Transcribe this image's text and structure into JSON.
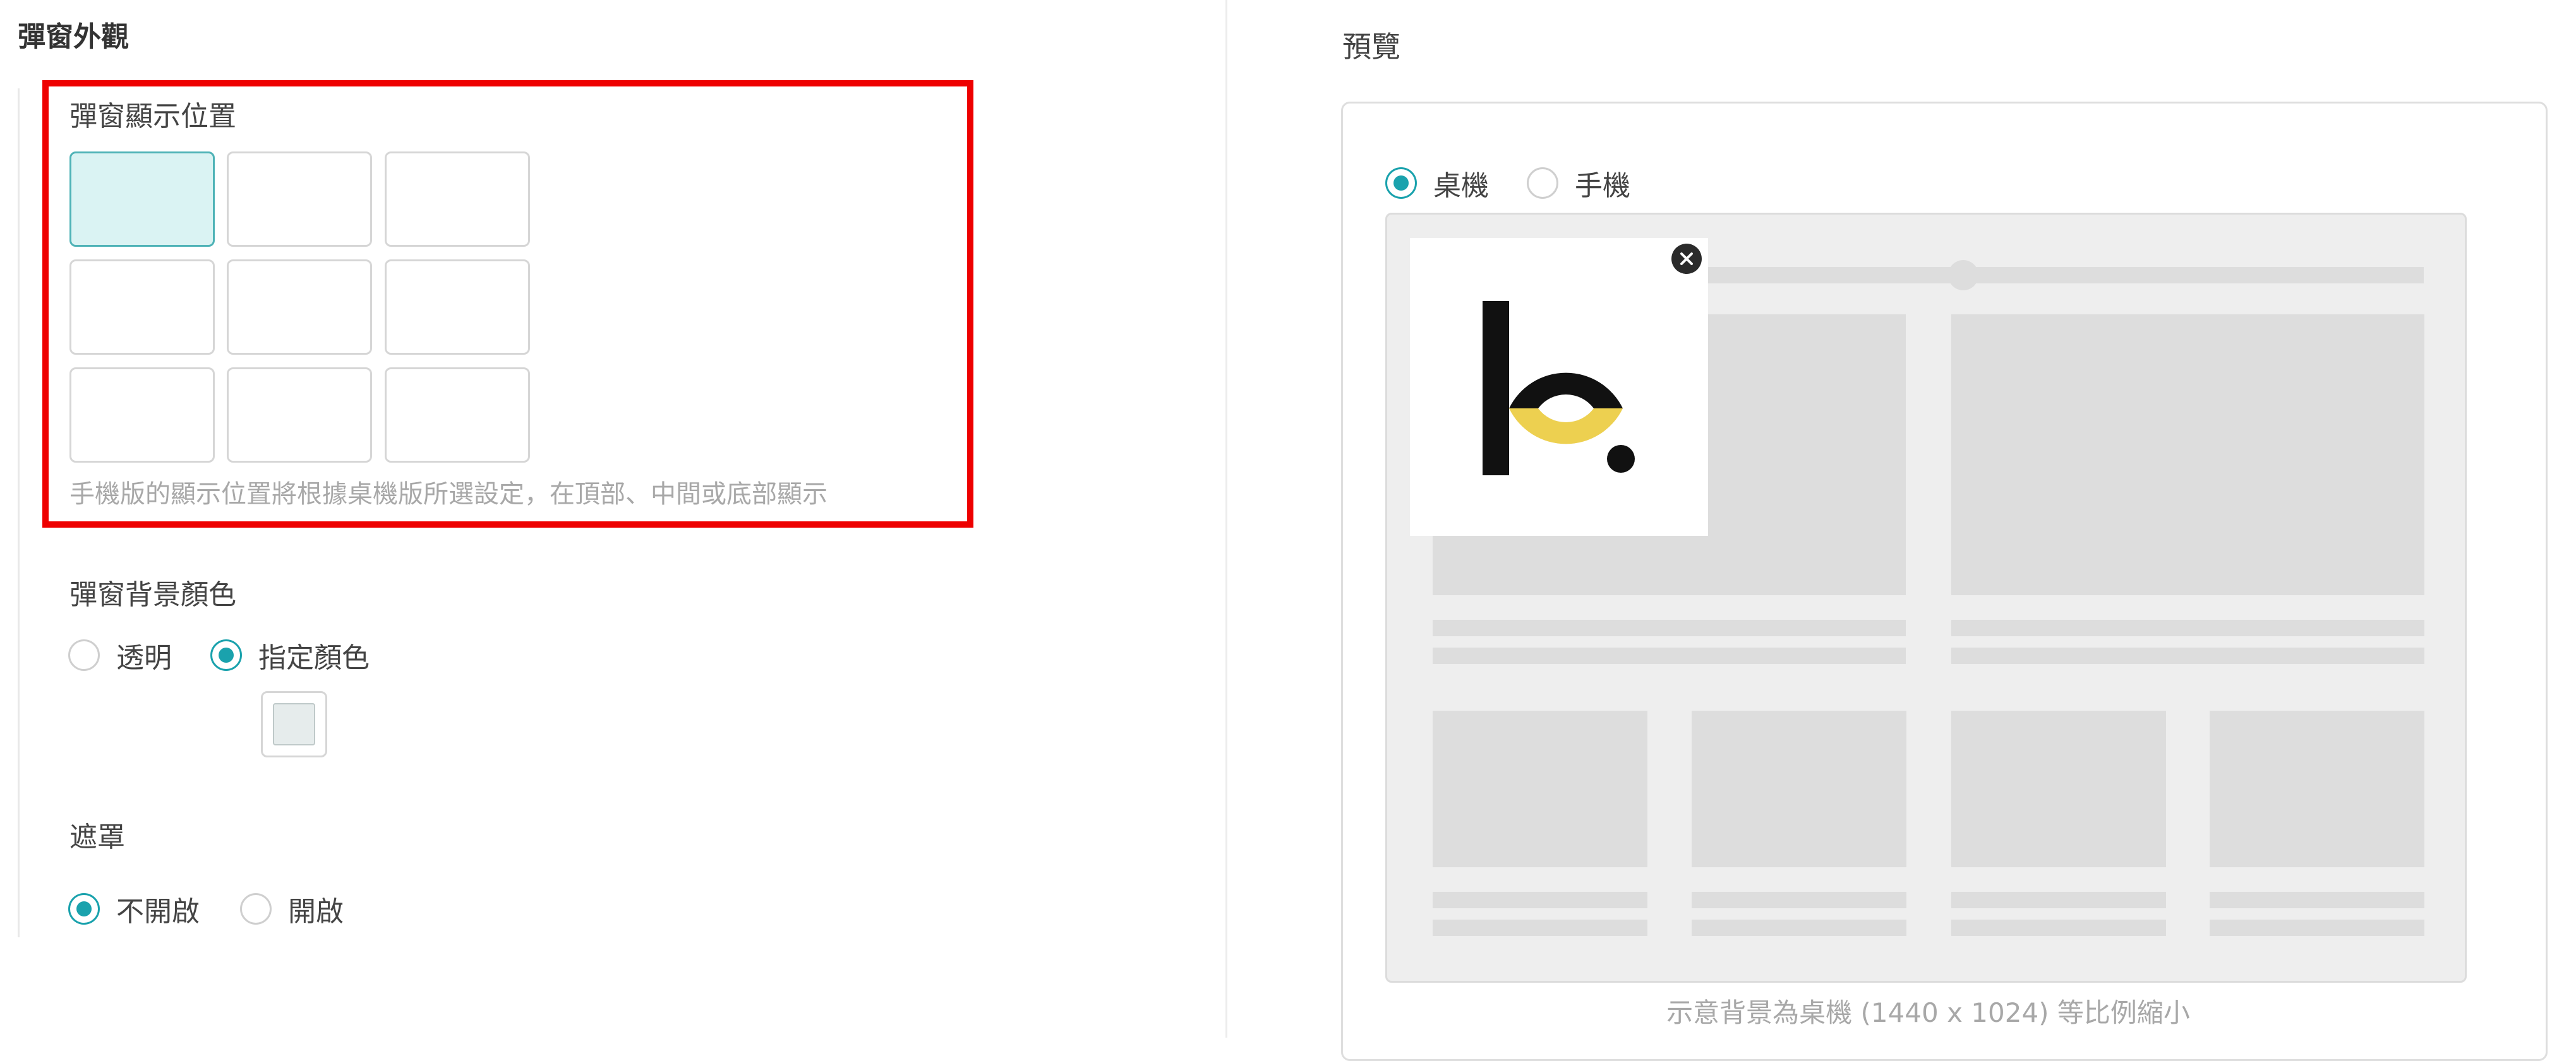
{
  "left": {
    "section_title": "彈窗外觀",
    "position": {
      "label": "彈窗顯示位置",
      "selected_cell": "top-left",
      "hint": "手機版的顯示位置將根據桌機版所選設定，在頂部、中間或底部顯示"
    },
    "background": {
      "label": "彈窗背景顏色",
      "options": [
        "透明",
        "指定顏色"
      ],
      "selected": "指定顏色",
      "swatch_color": "#e6ecec"
    },
    "mask": {
      "label": "遮罩",
      "options": [
        "不開啟",
        "開啟"
      ],
      "selected": "不開啟"
    }
  },
  "right": {
    "preview_title": "預覽",
    "device": {
      "options": [
        "桌機",
        "手機"
      ],
      "selected": "桌機"
    },
    "footnote": "示意背景為桌機 (1440 x 1024) 等比例縮小"
  },
  "colors": {
    "accent": "#1aa2ad",
    "highlight_border": "#ee0000",
    "selected_cell_bg": "#daf3f3",
    "placeholder": "#dddddd",
    "logo_yellow": "#edd050"
  },
  "icons": {
    "close": "close-icon",
    "logo": "brand-logo"
  }
}
